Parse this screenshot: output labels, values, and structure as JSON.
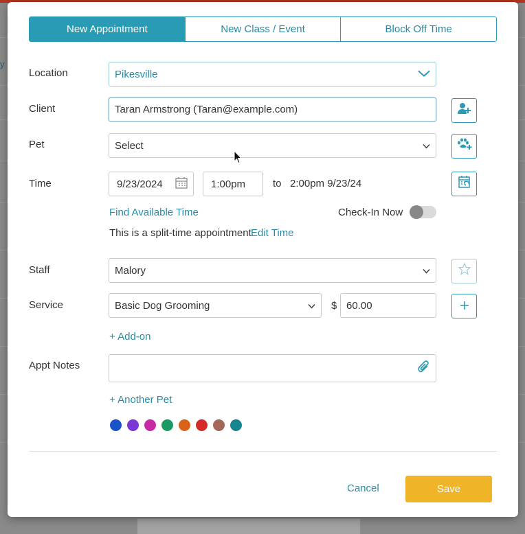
{
  "tabs": [
    "New Appointment",
    "New Class / Event",
    "Block Off Time"
  ],
  "location": {
    "label": "Location",
    "value": "Pikesville"
  },
  "client": {
    "label": "Client",
    "value": "Taran Armstrong (Taran@example.com)"
  },
  "pet": {
    "label": "Pet",
    "value": "Select"
  },
  "time": {
    "label": "Time",
    "date": "9/23/2024",
    "start": "1:00pm",
    "to": "to",
    "end": "2:00pm 9/23/24",
    "find_link": "Find Available Time",
    "checkin_label": "Check-In Now",
    "split_text": "This is a split-time appointment",
    "edit_link": "Edit Time"
  },
  "staff": {
    "label": "Staff",
    "value": "Malory"
  },
  "service": {
    "label": "Service",
    "value": "Basic Dog Grooming",
    "currency": "$",
    "price": "60.00",
    "addon_link": "+ Add-on"
  },
  "notes": {
    "label": "Appt Notes",
    "value": ""
  },
  "another_pet_link": "+ Another Pet",
  "colors": [
    "#1a52c8",
    "#7a36d6",
    "#c82aa5",
    "#1a9a63",
    "#d9621a",
    "#d62a2a",
    "#a3685a",
    "#178590"
  ],
  "footer": {
    "cancel": "Cancel",
    "save": "Save"
  },
  "backdrop_text": "y"
}
